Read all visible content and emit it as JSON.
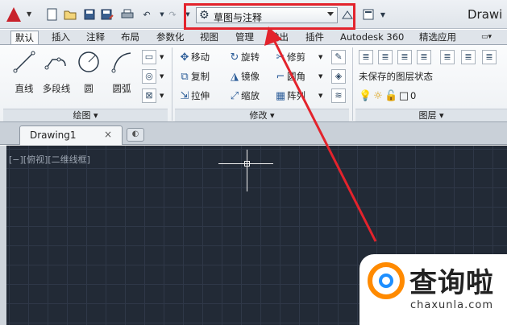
{
  "window": {
    "title": "Drawi"
  },
  "quick_access": {
    "icons": [
      "new-icon",
      "open-icon",
      "save-icon",
      "saveas-icon",
      "print-icon",
      "undo-icon",
      "redo-icon"
    ]
  },
  "workspace": {
    "value": "草图与注释"
  },
  "ribbon_tabs": [
    "默认",
    "插入",
    "注释",
    "布局",
    "参数化",
    "视图",
    "管理",
    "输出",
    "插件",
    "Autodesk 360",
    "精选应用"
  ],
  "draw_panel": {
    "title": "绘图 ▾",
    "tools": [
      "直线",
      "多段线",
      "圆",
      "圆弧"
    ]
  },
  "modify_panel": {
    "title": "修改 ▾",
    "tools": [
      "移动",
      "旋转",
      "修剪",
      "复制",
      "镜像",
      "圆角",
      "拉伸",
      "缩放",
      "阵列"
    ]
  },
  "layers_panel": {
    "title": "图层 ▾",
    "layer_state": "未保存的图层状态",
    "current_layer": "0"
  },
  "document": {
    "tab_label": "Drawing1",
    "close": "×"
  },
  "viewport": {
    "label": "[−][俯视][二维线框]"
  },
  "watermark": {
    "title": "查询啦",
    "domain": "chaxunla.com"
  },
  "colors": {
    "accent": "#e3232c",
    "canvas": "#222a36",
    "logo": "#c8222b"
  }
}
